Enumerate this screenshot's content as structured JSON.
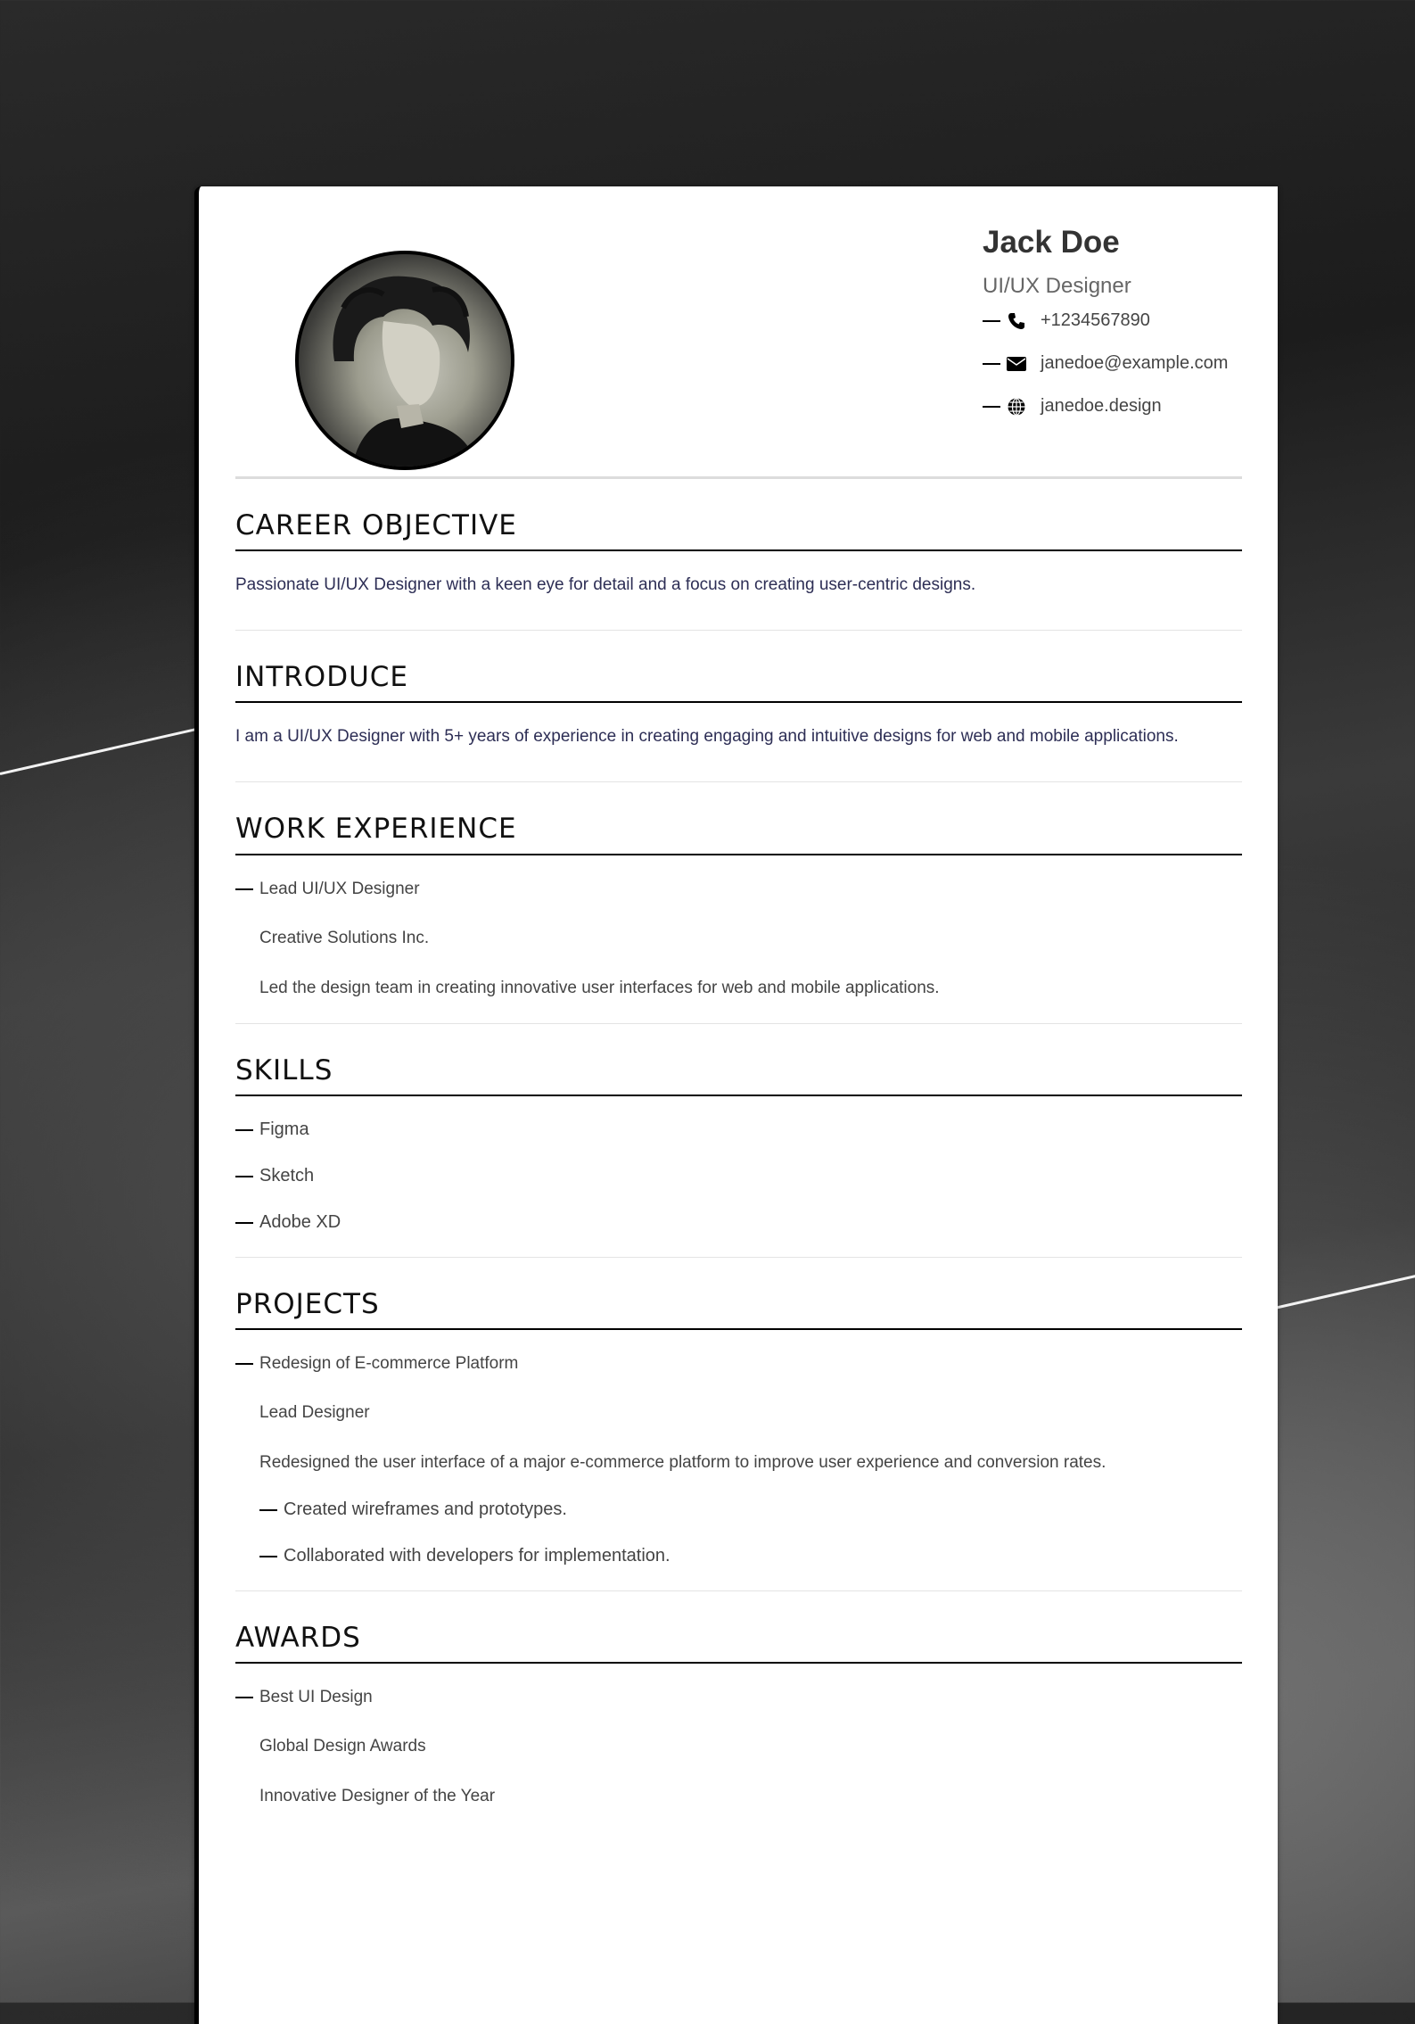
{
  "profile": {
    "name": "Jack Doe",
    "title": "UI/UX Designer",
    "phone": "+1234567890",
    "email": "janedoe@example.com",
    "website": "janedoe.design"
  },
  "career_objective": {
    "heading": "CAREER OBJECTIVE",
    "text": "Passionate UI/UX Designer with a keen eye for detail and a focus on creating user-centric designs."
  },
  "introduce": {
    "heading": "INTRODUCE",
    "text": "I am a UI/UX Designer with 5+ years of experience in creating engaging and intuitive designs for web and mobile applications."
  },
  "work_experience": {
    "heading": "WORK EXPERIENCE",
    "items": [
      {
        "role": "Lead UI/UX Designer",
        "company": "Creative Solutions Inc.",
        "description": "Led the design team in creating innovative user interfaces for web and mobile applications."
      }
    ]
  },
  "skills": {
    "heading": "SKILLS",
    "items": [
      "Figma",
      "Sketch",
      "Adobe XD"
    ]
  },
  "projects": {
    "heading": "PROJECTS",
    "items": [
      {
        "name": "Redesign of E-commerce Platform",
        "role": "Lead Designer",
        "description": "Redesigned the user interface of a major e-commerce platform to improve user experience and conversion rates.",
        "highlights": [
          "Created wireframes and prototypes.",
          "Collaborated with developers for implementation."
        ]
      }
    ]
  },
  "awards": {
    "heading": "AWARDS",
    "items": [
      {
        "name": "Best UI Design",
        "issuer": "Global Design Awards"
      },
      {
        "name": "Innovative Designer of the Year"
      }
    ]
  },
  "icons": {
    "phone": "phone-icon",
    "email": "envelope-icon",
    "website": "globe-icon"
  }
}
